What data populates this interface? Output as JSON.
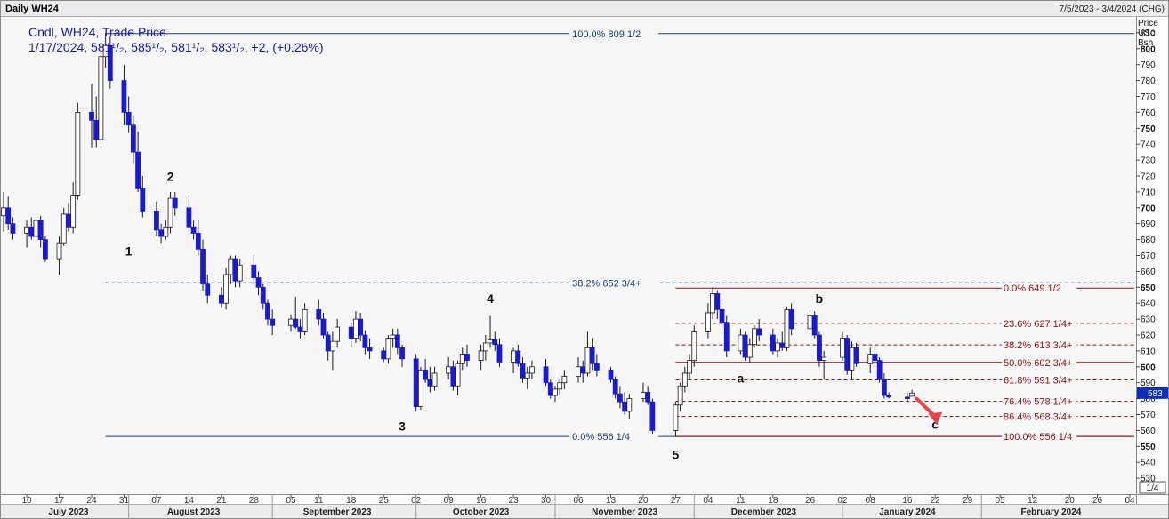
{
  "header": {
    "title": "Daily WH24",
    "date_range": "7/5/2023 - 3/4/2024 (CHG)"
  },
  "info": {
    "line1": "Cndl, WH24, Trade Price",
    "line2": "1/17/2024, 581¹/₂, 585¹/₂, 581¹/₂, 583¹/₂, +2, (+0.26%)"
  },
  "axis": {
    "unit_lines": [
      "Price",
      "USc",
      "Bsh"
    ],
    "current_price_marker": "583",
    "page_indicator": "1/4"
  },
  "chart_data": {
    "type": "candlestick",
    "title": "Daily WH24",
    "ylim": [
      520,
      820
    ],
    "yticks": [
      530,
      540,
      550,
      560,
      570,
      580,
      590,
      600,
      610,
      620,
      630,
      640,
      650,
      660,
      670,
      680,
      690,
      700,
      710,
      720,
      730,
      740,
      750,
      760,
      770,
      780,
      790,
      800,
      810
    ],
    "major_yticks": [
      550,
      600,
      650,
      700,
      750,
      800
    ],
    "xlim": [
      "2023-07-05",
      "2024-03-04"
    ],
    "x_day_ticks": [
      {
        "date": "2023-07-10",
        "label": "10"
      },
      {
        "date": "2023-07-17",
        "label": "17"
      },
      {
        "date": "2023-07-24",
        "label": "24"
      },
      {
        "date": "2023-07-31",
        "label": "31"
      },
      {
        "date": "2023-08-07",
        "label": "07"
      },
      {
        "date": "2023-08-14",
        "label": "14"
      },
      {
        "date": "2023-08-21",
        "label": "21"
      },
      {
        "date": "2023-08-28",
        "label": "28"
      },
      {
        "date": "2023-09-05",
        "label": "05"
      },
      {
        "date": "2023-09-11",
        "label": "11"
      },
      {
        "date": "2023-09-18",
        "label": "18"
      },
      {
        "date": "2023-09-25",
        "label": "25"
      },
      {
        "date": "2023-10-02",
        "label": "02"
      },
      {
        "date": "2023-10-09",
        "label": "09"
      },
      {
        "date": "2023-10-16",
        "label": "16"
      },
      {
        "date": "2023-10-23",
        "label": "23"
      },
      {
        "date": "2023-10-30",
        "label": "30"
      },
      {
        "date": "2023-11-06",
        "label": "06"
      },
      {
        "date": "2023-11-13",
        "label": "13"
      },
      {
        "date": "2023-11-20",
        "label": "20"
      },
      {
        "date": "2023-11-27",
        "label": "27"
      },
      {
        "date": "2023-12-04",
        "label": "04"
      },
      {
        "date": "2023-12-11",
        "label": "11"
      },
      {
        "date": "2023-12-18",
        "label": "18"
      },
      {
        "date": "2023-12-26",
        "label": "26"
      },
      {
        "date": "2024-01-02",
        "label": "02"
      },
      {
        "date": "2024-01-08",
        "label": "08"
      },
      {
        "date": "2024-01-16",
        "label": "16"
      },
      {
        "date": "2024-01-22",
        "label": "22"
      },
      {
        "date": "2024-01-29",
        "label": "29"
      },
      {
        "date": "2024-02-05",
        "label": "05"
      },
      {
        "date": "2024-02-12",
        "label": "12"
      },
      {
        "date": "2024-02-20",
        "label": "20"
      },
      {
        "date": "2024-02-26",
        "label": "26"
      },
      {
        "date": "2024-03-04",
        "label": "04"
      }
    ],
    "x_month_labels": [
      {
        "date": "2023-07-19",
        "label": "July 2023"
      },
      {
        "date": "2023-08-15",
        "label": "August 2023"
      },
      {
        "date": "2023-09-15",
        "label": "September 2023"
      },
      {
        "date": "2023-10-16",
        "label": "October 2023"
      },
      {
        "date": "2023-11-16",
        "label": "November 2023"
      },
      {
        "date": "2023-12-16",
        "label": "December 2023"
      },
      {
        "date": "2024-01-16",
        "label": "January 2024"
      },
      {
        "date": "2024-02-16",
        "label": "February 2024"
      }
    ],
    "month_separators": [
      "2023-08-01",
      "2023-09-01",
      "2023-10-02",
      "2023-11-01",
      "2023-12-01",
      "2024-01-02",
      "2024-02-01"
    ],
    "candles": [
      [
        "2023-07-05",
        695,
        710,
        685,
        700
      ],
      [
        "2023-07-06",
        700,
        707,
        686,
        690
      ],
      [
        "2023-07-07",
        690,
        694,
        680,
        684
      ],
      [
        "2023-07-10",
        684,
        692,
        675,
        688
      ],
      [
        "2023-07-11",
        688,
        694,
        680,
        682
      ],
      [
        "2023-07-12",
        682,
        696,
        680,
        692
      ],
      [
        "2023-07-13",
        692,
        695,
        675,
        680
      ],
      [
        "2023-07-14",
        680,
        682,
        666,
        668
      ],
      [
        "2023-07-17",
        668,
        682,
        658,
        678
      ],
      [
        "2023-07-18",
        678,
        700,
        676,
        696
      ],
      [
        "2023-07-19",
        696,
        703,
        685,
        688
      ],
      [
        "2023-07-20",
        688,
        716,
        684,
        708
      ],
      [
        "2023-07-21",
        708,
        766,
        705,
        760
      ],
      [
        "2023-07-24",
        760,
        778,
        738,
        755
      ],
      [
        "2023-07-25",
        755,
        770,
        738,
        743
      ],
      [
        "2023-07-26",
        743,
        800,
        740,
        795
      ],
      [
        "2023-07-27",
        795,
        810,
        788,
        802
      ],
      [
        "2023-07-28",
        802,
        808,
        775,
        780
      ],
      [
        "2023-07-31",
        780,
        790,
        752,
        760
      ],
      [
        "2023-08-01",
        760,
        770,
        747,
        752
      ],
      [
        "2023-08-02",
        752,
        758,
        728,
        735
      ],
      [
        "2023-08-03",
        735,
        748,
        710,
        712
      ],
      [
        "2023-08-04",
        712,
        720,
        694,
        698
      ],
      [
        "2023-08-07",
        698,
        704,
        682,
        686
      ],
      [
        "2023-08-08",
        686,
        690,
        678,
        682
      ],
      [
        "2023-08-09",
        682,
        692,
        680,
        688
      ],
      [
        "2023-08-10",
        688,
        710,
        684,
        706
      ],
      [
        "2023-08-11",
        706,
        710,
        695,
        700
      ],
      [
        "2023-08-14",
        700,
        708,
        685,
        688
      ],
      [
        "2023-08-15",
        688,
        692,
        680,
        684
      ],
      [
        "2023-08-16",
        684,
        692,
        670,
        674
      ],
      [
        "2023-08-17",
        674,
        680,
        648,
        652
      ],
      [
        "2023-08-18",
        652,
        658,
        640,
        645
      ],
      [
        "2023-08-21",
        645,
        650,
        637,
        640
      ],
      [
        "2023-08-22",
        640,
        662,
        636,
        658
      ],
      [
        "2023-08-23",
        658,
        670,
        652,
        668
      ],
      [
        "2023-08-24",
        668,
        670,
        650,
        654
      ],
      [
        "2023-08-25",
        654,
        668,
        650,
        664
      ],
      [
        "2023-08-28",
        664,
        670,
        652,
        656
      ],
      [
        "2023-08-29",
        656,
        660,
        645,
        650
      ],
      [
        "2023-08-30",
        650,
        652,
        636,
        640
      ],
      [
        "2023-08-31",
        640,
        642,
        626,
        630
      ],
      [
        "2023-09-01",
        630,
        636,
        620,
        626
      ],
      [
        "2023-09-05",
        626,
        633,
        622,
        630
      ],
      [
        "2023-09-06",
        630,
        644,
        624,
        625
      ],
      [
        "2023-09-07",
        625,
        630,
        618,
        622
      ],
      [
        "2023-09-08",
        622,
        640,
        620,
        636
      ],
      [
        "2023-09-11",
        636,
        642,
        626,
        630
      ],
      [
        "2023-09-12",
        630,
        634,
        618,
        620
      ],
      [
        "2023-09-13",
        620,
        622,
        604,
        610
      ],
      [
        "2023-09-14",
        610,
        622,
        598,
        616
      ],
      [
        "2023-09-15",
        616,
        630,
        612,
        625
      ],
      [
        "2023-09-18",
        625,
        628,
        612,
        618
      ],
      [
        "2023-09-19",
        618,
        635,
        615,
        630
      ],
      [
        "2023-09-20",
        630,
        634,
        616,
        620
      ],
      [
        "2023-09-21",
        620,
        623,
        608,
        612
      ],
      [
        "2023-09-22",
        612,
        618,
        605,
        610
      ],
      [
        "2023-09-25",
        610,
        612,
        603,
        605
      ],
      [
        "2023-09-26",
        605,
        620,
        602,
        618
      ],
      [
        "2023-09-27",
        618,
        624,
        612,
        620
      ],
      [
        "2023-09-28",
        620,
        624,
        608,
        612
      ],
      [
        "2023-09-29",
        612,
        614,
        600,
        605
      ],
      [
        "2023-10-02",
        605,
        608,
        572,
        575
      ],
      [
        "2023-10-03",
        575,
        600,
        573,
        598
      ],
      [
        "2023-10-04",
        598,
        605,
        590,
        592
      ],
      [
        "2023-10-05",
        592,
        600,
        584,
        588
      ],
      [
        "2023-10-06",
        588,
        600,
        585,
        596
      ],
      [
        "2023-10-09",
        596,
        606,
        592,
        600
      ],
      [
        "2023-10-10",
        600,
        604,
        585,
        588
      ],
      [
        "2023-10-11",
        588,
        604,
        582,
        602
      ],
      [
        "2023-10-12",
        602,
        612,
        598,
        608
      ],
      [
        "2023-10-13",
        608,
        614,
        600,
        604
      ],
      [
        "2023-10-16",
        604,
        614,
        598,
        610
      ],
      [
        "2023-10-17",
        610,
        620,
        604,
        615
      ],
      [
        "2023-10-18",
        615,
        632,
        612,
        617
      ],
      [
        "2023-10-19",
        617,
        622,
        610,
        614
      ],
      [
        "2023-10-20",
        614,
        618,
        600,
        603
      ],
      [
        "2023-10-23",
        603,
        612,
        596,
        610
      ],
      [
        "2023-10-24",
        610,
        614,
        600,
        602
      ],
      [
        "2023-10-25",
        602,
        606,
        590,
        593
      ],
      [
        "2023-10-26",
        593,
        600,
        586,
        596
      ],
      [
        "2023-10-27",
        596,
        604,
        592,
        600
      ],
      [
        "2023-10-30",
        600,
        605,
        588,
        590
      ],
      [
        "2023-10-31",
        590,
        592,
        580,
        582
      ],
      [
        "2023-11-01",
        582,
        588,
        578,
        586
      ],
      [
        "2023-11-02",
        586,
        592,
        582,
        590
      ],
      [
        "2023-11-03",
        590,
        598,
        586,
        594
      ],
      [
        "2023-11-06",
        594,
        606,
        590,
        600
      ],
      [
        "2023-11-07",
        600,
        604,
        590,
        596
      ],
      [
        "2023-11-08",
        596,
        622,
        594,
        612
      ],
      [
        "2023-11-09",
        612,
        618,
        598,
        602
      ],
      [
        "2023-11-10",
        602,
        608,
        594,
        598
      ],
      [
        "2023-11-13",
        598,
        600,
        590,
        592
      ],
      [
        "2023-11-14",
        592,
        594,
        580,
        583
      ],
      [
        "2023-11-15",
        583,
        588,
        574,
        578
      ],
      [
        "2023-11-16",
        578,
        584,
        570,
        572
      ],
      [
        "2023-11-17",
        572,
        583,
        567,
        580
      ],
      [
        "2023-11-20",
        580,
        590,
        578,
        584
      ],
      [
        "2023-11-21",
        584,
        588,
        576,
        578
      ],
      [
        "2023-11-22",
        578,
        580,
        558,
        560
      ],
      [
        "2023-11-27",
        560,
        578,
        556,
        576
      ],
      [
        "2023-11-28",
        576,
        590,
        572,
        588
      ],
      [
        "2023-11-29",
        588,
        600,
        584,
        596
      ],
      [
        "2023-11-30",
        596,
        608,
        592,
        604
      ],
      [
        "2023-12-01",
        604,
        626,
        600,
        622
      ],
      [
        "2023-12-04",
        622,
        640,
        618,
        634
      ],
      [
        "2023-12-05",
        634,
        650,
        630,
        646
      ],
      [
        "2023-12-06",
        646,
        648,
        630,
        636
      ],
      [
        "2023-12-07",
        636,
        640,
        624,
        628
      ],
      [
        "2023-12-08",
        628,
        632,
        606,
        610
      ],
      [
        "2023-12-11",
        610,
        624,
        608,
        620
      ],
      [
        "2023-12-12",
        620,
        622,
        604,
        606
      ],
      [
        "2023-12-13",
        606,
        618,
        603,
        614
      ],
      [
        "2023-12-14",
        614,
        626,
        612,
        624
      ],
      [
        "2023-12-15",
        624,
        630,
        616,
        620
      ],
      [
        "2023-12-18",
        620,
        624,
        608,
        610
      ],
      [
        "2023-12-19",
        610,
        618,
        606,
        615
      ],
      [
        "2023-12-20",
        615,
        622,
        610,
        612
      ],
      [
        "2023-12-21",
        612,
        638,
        610,
        636
      ],
      [
        "2023-12-22",
        636,
        640,
        620,
        624
      ],
      [
        "2023-12-26",
        624,
        636,
        622,
        632
      ],
      [
        "2023-12-27",
        632,
        635,
        618,
        620
      ],
      [
        "2023-12-28",
        620,
        622,
        600,
        604
      ],
      [
        "2023-12-29",
        604,
        610,
        592,
        606
      ],
      [
        "2024-01-02",
        606,
        622,
        604,
        618
      ],
      [
        "2024-01-03",
        618,
        620,
        595,
        598
      ],
      [
        "2024-01-04",
        598,
        616,
        592,
        612
      ],
      [
        "2024-01-05",
        612,
        615,
        600,
        602
      ],
      [
        "2024-01-08",
        602,
        612,
        596,
        608
      ],
      [
        "2024-01-09",
        608,
        614,
        600,
        604
      ],
      [
        "2024-01-10",
        604,
        606,
        590,
        592
      ],
      [
        "2024-01-11",
        592,
        596,
        580,
        582
      ],
      [
        "2024-01-12",
        582,
        584,
        580,
        581
      ],
      [
        "2024-01-16",
        581,
        584,
        578,
        580
      ],
      [
        "2024-01-17",
        581.5,
        585.5,
        581.5,
        583.5
      ]
    ],
    "fib_left": {
      "x_start": "2023-07-27",
      "levels": [
        {
          "label": "100.0%",
          "value_text": "809 1/2",
          "price": 809.5,
          "style": "solid"
        },
        {
          "label": "38.2%",
          "value_text": "652 3/4+",
          "price": 652.8,
          "style": "dashed"
        },
        {
          "label": "0.0%",
          "value_text": "556 1/4",
          "price": 556.25,
          "style": "solid"
        }
      ]
    },
    "fib_right": {
      "x_start": "2023-11-27",
      "levels": [
        {
          "label": "0.0%",
          "value_text": "649 1/2",
          "price": 649.5,
          "style": "solid"
        },
        {
          "label": "23.6%",
          "value_text": "627 1/4+",
          "price": 627.3,
          "style": "dashed"
        },
        {
          "label": "38.2%",
          "value_text": "613 3/4+",
          "price": 613.8,
          "style": "dashed"
        },
        {
          "label": "50.0%",
          "value_text": "602 3/4+",
          "price": 602.8,
          "style": "solid"
        },
        {
          "label": "61.8%",
          "value_text": "591 3/4+",
          "price": 591.8,
          "style": "dashed"
        },
        {
          "label": "76.4%",
          "value_text": "578 1/4+",
          "price": 578.3,
          "style": "dashed"
        },
        {
          "label": "86.4%",
          "value_text": "568 3/4+",
          "price": 568.8,
          "style": "dashed"
        },
        {
          "label": "100.0%",
          "value_text": "556 1/4",
          "price": 556.25,
          "style": "solid"
        }
      ]
    },
    "wave_labels": [
      {
        "text": "1",
        "date": "2023-08-01",
        "price": 670
      },
      {
        "text": "2",
        "date": "2023-08-10",
        "price": 717
      },
      {
        "text": "3",
        "date": "2023-09-29",
        "price": 560
      },
      {
        "text": "4",
        "date": "2023-10-18",
        "price": 640
      },
      {
        "text": "5",
        "date": "2023-11-27",
        "price": 542
      },
      {
        "text": "a",
        "date": "2023-12-11",
        "price": 590
      },
      {
        "text": "b",
        "date": "2023-12-28",
        "price": 640
      },
      {
        "text": "c",
        "date": "2024-01-22",
        "price": 561
      }
    ],
    "projection_arrow": {
      "from_date": "2024-01-18",
      "from_price": 580,
      "to_date": "2024-01-22",
      "to_price": 566,
      "color": "#e8454a"
    },
    "colors": {
      "up_candle": "#ffffff",
      "down_candle": "#1a1ad0",
      "wick": "#1a1a1a",
      "fib_blue": "#1d3f73",
      "fib_red": "#8a1212",
      "price_marker": "#0b2fb8"
    }
  }
}
